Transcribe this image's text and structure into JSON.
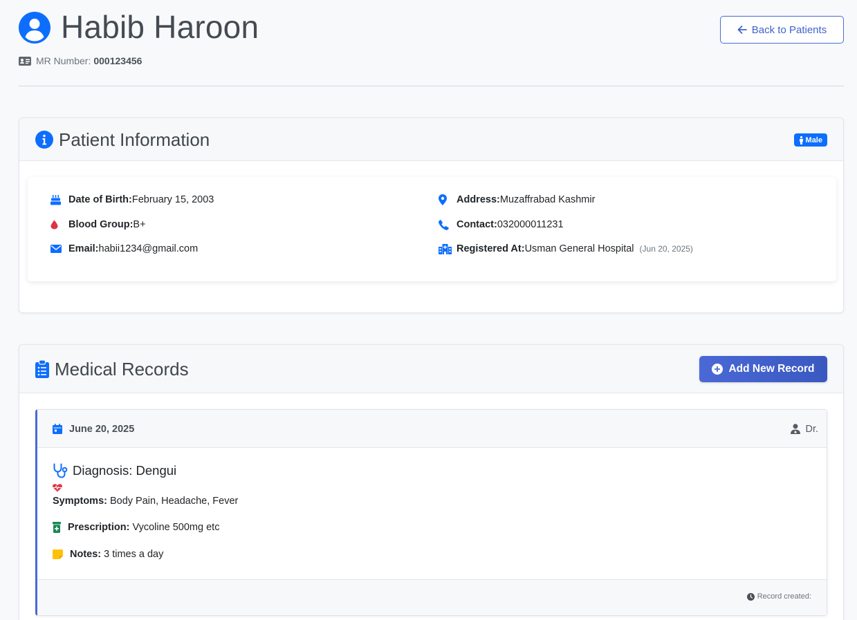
{
  "header": {
    "patient_name": "Habib Haroon",
    "mr_label": "MR Number:",
    "mr_number": "000123456",
    "back_button": "Back to Patients"
  },
  "patient_info": {
    "title": "Patient Information",
    "gender_badge": "Male",
    "fields": [
      {
        "label": "Date of Birth:",
        "value": "February 15, 2003",
        "icon": "birthday-cake-icon"
      },
      {
        "label": "Blood Group:",
        "value": "B+",
        "icon": "blood-drop-icon"
      },
      {
        "label": "Email:",
        "value": "habii1234@gmail.com",
        "icon": "envelope-icon"
      },
      {
        "label": "Address:",
        "value": "Muzaffrabad Kashmir",
        "icon": "map-pin-icon"
      },
      {
        "label": "Contact:",
        "value": "032000011231",
        "icon": "phone-icon"
      },
      {
        "label": "Registered At:",
        "value": "Usman General Hospital",
        "date": "(Jun 20, 2025)",
        "icon": "hospital-icon"
      }
    ]
  },
  "medical_records": {
    "title": "Medical Records",
    "add_button": "Add New Record",
    "records": [
      {
        "date": "June 20, 2025",
        "doctor": "Dr.",
        "diagnosis": "Diagnosis: Dengui",
        "symptoms_label": "Symptoms:",
        "symptoms": "Body Pain, Headache, Fever",
        "prescription_label": "Prescription:",
        "prescription": "Vycoline 500mg etc",
        "notes_label": "Notes:",
        "notes": "3 times a day",
        "created_label": "Record created:"
      }
    ]
  },
  "colors": {
    "primary": "#0d6efd",
    "accent": "#4a69d6",
    "danger": "#dc3545",
    "success": "#198754",
    "warning": "#ffc107"
  }
}
